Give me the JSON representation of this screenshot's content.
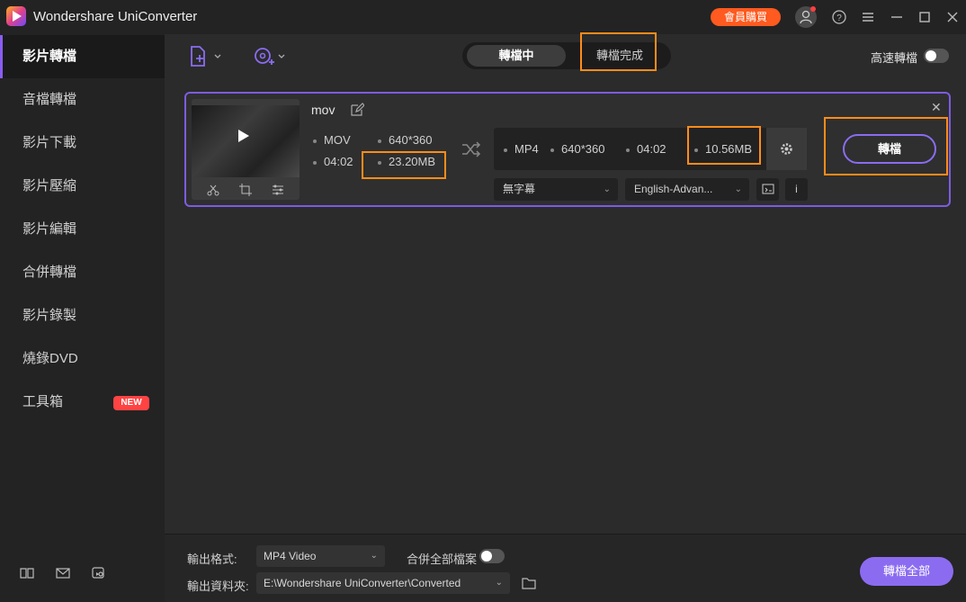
{
  "app": {
    "title": "Wondershare UniConverter",
    "member_label": "會員購買"
  },
  "sidebar": {
    "items": [
      {
        "label": "影片轉檔"
      },
      {
        "label": "音檔轉檔"
      },
      {
        "label": "影片下載"
      },
      {
        "label": "影片壓縮"
      },
      {
        "label": "影片編輯"
      },
      {
        "label": "合併轉檔"
      },
      {
        "label": "影片錄製"
      },
      {
        "label": "燒錄DVD"
      },
      {
        "label": "工具箱"
      }
    ],
    "new_badge": "NEW"
  },
  "toolbar": {
    "tab_converting": "轉檔中",
    "tab_done": "轉檔完成",
    "fast_convert_label": "高速轉檔"
  },
  "task": {
    "filename": "mov",
    "source": {
      "format": "MOV",
      "resolution": "640*360",
      "duration": "04:02",
      "size": "23.20MB"
    },
    "target": {
      "format": "MP4",
      "resolution": "640*360",
      "duration": "04:02",
      "size": "10.56MB"
    },
    "subtitle_option": "無字幕",
    "audio_option": "English-Advan...",
    "convert_label": "轉檔"
  },
  "footer": {
    "output_format_label": "輸出格式:",
    "output_format_value": "MP4 Video",
    "merge_label": "合併全部檔案",
    "output_folder_label": "輸出資料夾:",
    "output_folder_value": "E:\\Wondershare UniConverter\\Converted",
    "convert_all_label": "轉檔全部"
  },
  "colors": {
    "accent": "#8b6cf0",
    "member": "#ff5a1f",
    "highlight": "#ff8c1a"
  }
}
